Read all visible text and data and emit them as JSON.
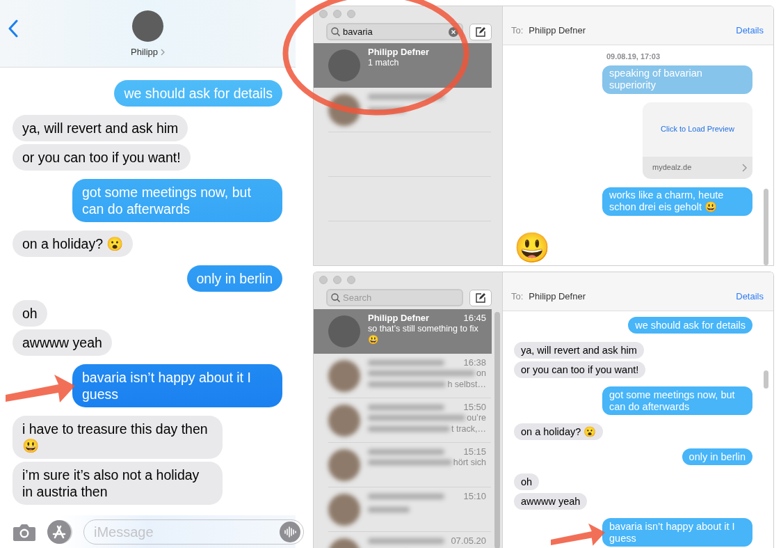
{
  "phone": {
    "contact": "Philipp",
    "messages": [
      {
        "kind": "sent",
        "text": "we should ask for details",
        "marked": false
      },
      {
        "kind": "received",
        "text": "ya, will revert and ask him",
        "marked": false
      },
      {
        "kind": "received",
        "text": "or you can too if you want!",
        "marked": false
      },
      {
        "kind": "sent",
        "text": "got some meetings now, but can do afterwards",
        "marked": false
      },
      {
        "kind": "received",
        "text": "on a holiday? 😮",
        "marked": false
      },
      {
        "kind": "sent",
        "text": "only in berlin",
        "marked": false
      },
      {
        "kind": "received",
        "text": "oh",
        "marked": false
      },
      {
        "kind": "received",
        "text": "awwww yeah",
        "marked": false
      },
      {
        "kind": "sent",
        "text": "bavaria isn’t happy about it I guess",
        "marked": true
      },
      {
        "kind": "received",
        "text": "i have to treasure this day then 😃",
        "marked": false
      },
      {
        "kind": "received",
        "text": "i’m sure it’s also not a holiday in austria then",
        "marked": false
      }
    ],
    "composer": {
      "placeholder": "iMessage"
    }
  },
  "windows": [
    {
      "search": {
        "value": "bavaria",
        "circled": true
      },
      "list_scrollbar": false,
      "conversations": [
        {
          "name": "Philipp Defner",
          "preview": [
            "1 match"
          ],
          "selected": true
        },
        {
          "selected": false
        }
      ],
      "header": {
        "to_label": "To:",
        "recipient": "Philipp Defner",
        "details_link": "Details"
      },
      "messages": [
        {
          "kind": "timestamp",
          "text": "09.08.19, 17:03"
        },
        {
          "kind": "sent",
          "text": "speaking of bavarian superiority",
          "highlighted": true,
          "marked": false
        },
        {
          "kind": "link",
          "action": "Click to Load Preview",
          "site": "mydealz.de"
        },
        {
          "kind": "sent",
          "text": "works like a charm, heute schon drei eis geholt 😃",
          "highlighted": false,
          "marked": false
        },
        {
          "kind": "emoji",
          "text": "😃"
        }
      ]
    },
    {
      "search": {
        "placeholder": "Search",
        "circled": false
      },
      "list_scrollbar": true,
      "conversations": [
        {
          "name": "Philipp Defner",
          "time": "16:45",
          "preview": [
            "so that’s still something to fix",
            "😃"
          ],
          "selected": true
        },
        {
          "time": "16:38",
          "preview": [
            "on",
            "h selbst…"
          ],
          "selected": false
        },
        {
          "time": "15:50",
          "preview": [
            "ou’re",
            "t track,…"
          ],
          "selected": false
        },
        {
          "time": "15:15",
          "preview": [
            "hört sich"
          ],
          "selected": false
        },
        {
          "time": "15:10",
          "selected": false
        },
        {
          "time": "07.05.20",
          "selected": false
        }
      ],
      "header": {
        "to_label": "To:",
        "recipient": "Philipp Defner",
        "details_link": "Details"
      },
      "messages": [
        {
          "kind": "sent",
          "text": "we should ask for details",
          "highlighted": false,
          "marked": false
        },
        {
          "kind": "received",
          "text": "ya, will revert and ask him",
          "marked": false
        },
        {
          "kind": "received",
          "text": "or you can too if you want!",
          "marked": false
        },
        {
          "kind": "sent",
          "text": "got some meetings now, but can do afterwards",
          "highlighted": false,
          "marked": false
        },
        {
          "kind": "received",
          "text": "on a holiday? 😮",
          "marked": false
        },
        {
          "kind": "sent",
          "text": "only in berlin",
          "highlighted": false,
          "marked": false
        },
        {
          "kind": "received",
          "text": "oh",
          "marked": false
        },
        {
          "kind": "received",
          "text": "awwww yeah",
          "marked": false
        },
        {
          "kind": "sent",
          "text": "bavaria isn’t happy about it I guess",
          "highlighted": false,
          "marked": true
        }
      ]
    }
  ]
}
